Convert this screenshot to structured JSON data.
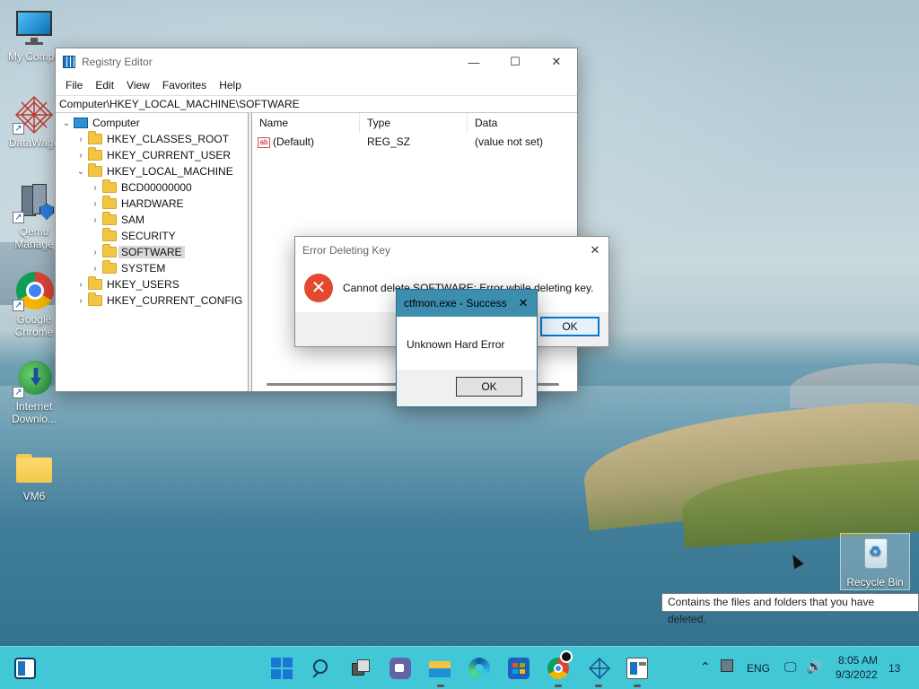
{
  "desktop": {
    "icons": [
      {
        "label": "My Compu",
        "icon": "monitor-icon"
      },
      {
        "label": "DataWago",
        "icon": "datawagon-icon"
      },
      {
        "label": "Qemu Manage",
        "icon": "qemu-manager-icon"
      },
      {
        "label": "Google Chrome",
        "icon": "chrome-icon"
      },
      {
        "label": "Internet Downlo...",
        "icon": "internet-download-manager-icon"
      },
      {
        "label": "VM6",
        "icon": "folder-icon"
      },
      {
        "label": "Recycle Bin",
        "icon": "recycle-bin-icon"
      }
    ],
    "tooltip": "Contains the files and folders that you have deleted."
  },
  "regedit": {
    "title": "Registry Editor",
    "menu": [
      "File",
      "Edit",
      "View",
      "Favorites",
      "Help"
    ],
    "address": "Computer\\HKEY_LOCAL_MACHINE\\SOFTWARE",
    "tree": [
      {
        "label": "Computer",
        "level": 0,
        "arrow": "expanded",
        "icon": "computer-icon"
      },
      {
        "label": "HKEY_CLASSES_ROOT",
        "level": 1,
        "arrow": "collapsed",
        "icon": "folder-icon"
      },
      {
        "label": "HKEY_CURRENT_USER",
        "level": 1,
        "arrow": "collapsed",
        "icon": "folder-icon"
      },
      {
        "label": "HKEY_LOCAL_MACHINE",
        "level": 1,
        "arrow": "expanded",
        "icon": "folder-icon"
      },
      {
        "label": "BCD00000000",
        "level": 2,
        "arrow": "collapsed",
        "icon": "folder-icon"
      },
      {
        "label": "HARDWARE",
        "level": 2,
        "arrow": "collapsed",
        "icon": "folder-icon"
      },
      {
        "label": "SAM",
        "level": 2,
        "arrow": "collapsed",
        "icon": "folder-icon"
      },
      {
        "label": "SECURITY",
        "level": 2,
        "arrow": "none",
        "icon": "folder-icon"
      },
      {
        "label": "SOFTWARE",
        "level": 2,
        "arrow": "collapsed",
        "icon": "folder-icon",
        "selected": true
      },
      {
        "label": "SYSTEM",
        "level": 2,
        "arrow": "collapsed",
        "icon": "folder-icon"
      },
      {
        "label": "HKEY_USERS",
        "level": 1,
        "arrow": "collapsed",
        "icon": "folder-icon"
      },
      {
        "label": "HKEY_CURRENT_CONFIG",
        "level": 1,
        "arrow": "collapsed",
        "icon": "folder-icon"
      }
    ],
    "columns": [
      "Name",
      "Type",
      "Data"
    ],
    "rows": [
      {
        "name": "(Default)",
        "type": "REG_SZ",
        "data": "(value not set)",
        "icon": "string-value-icon"
      }
    ]
  },
  "error_dialog": {
    "title": "Error Deleting Key",
    "message": "Cannot delete SOFTWARE:  Error while deleting key.",
    "ok_label": "OK"
  },
  "ctfmon_dialog": {
    "title": "ctfmon.exe - Success",
    "message": "Unknown Hard Error",
    "ok_label": "OK"
  },
  "taskbar": {
    "apps": [
      "start-icon",
      "search-icon",
      "task-view-icon",
      "chat-icon",
      "file-explorer-icon",
      "edge-icon",
      "store-icon",
      "chrome-icon",
      "datawagon-icon",
      "registry-editor-icon"
    ],
    "tray": {
      "language": "ENG",
      "time": "8:05 AM",
      "date": "9/3/2022",
      "notification_count": "13"
    }
  }
}
